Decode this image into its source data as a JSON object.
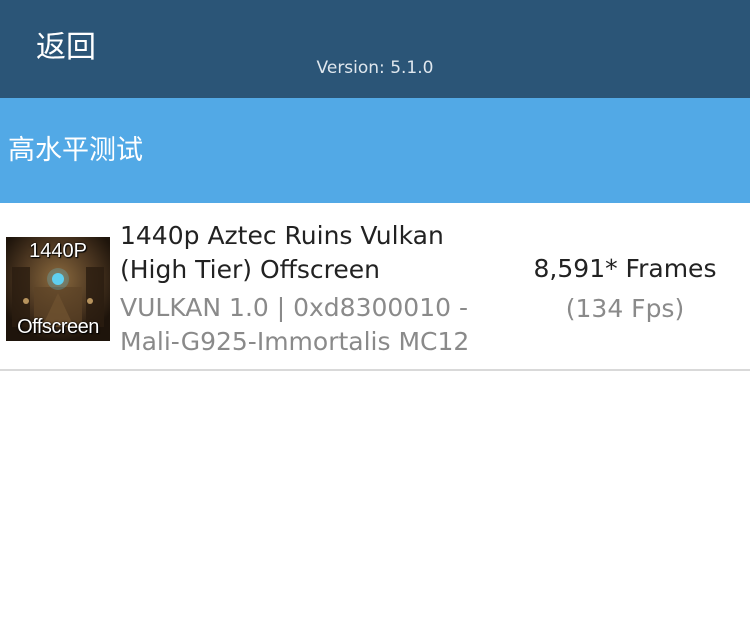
{
  "header": {
    "back_label": "返回",
    "version": "Version: 5.1.0"
  },
  "section": {
    "title": "高水平测试"
  },
  "results": [
    {
      "thumbnail": {
        "top_text": "1440P",
        "bottom_text": "Offscreen"
      },
      "title_line1": "1440p Aztec Ruins Vulkan",
      "title_line2": "(High Tier) Offscreen",
      "detail_line1": "VULKAN 1.0 | 0xd8300010 -",
      "detail_line2": "Mali-G925-Immortalis MC12",
      "score": "8,591* Frames",
      "fps": "(134 Fps)"
    }
  ],
  "colors": {
    "topbar": "#2b5577",
    "section_header": "#52a9e6",
    "divider": "#d9d9d9"
  }
}
